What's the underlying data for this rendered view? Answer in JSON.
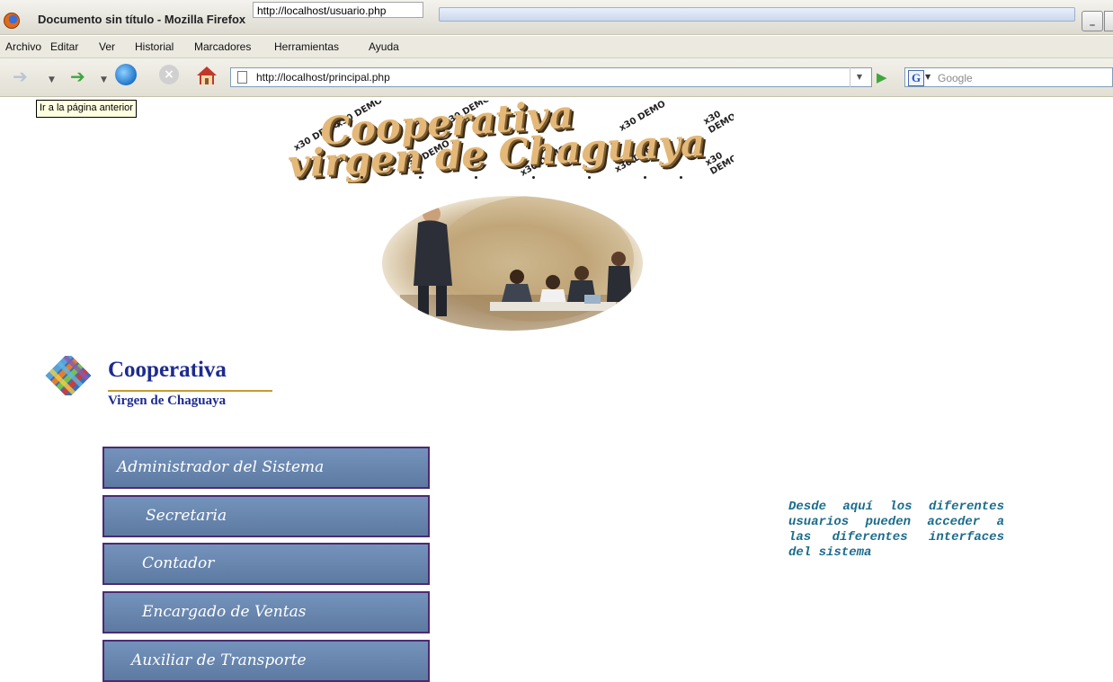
{
  "browser": {
    "window_title": "Documento sin título - Mozilla Firefox",
    "status_tooltip": "http://localhost/usuario.php",
    "minimize_glyph": "_",
    "menu": [
      "Archivo",
      "Editar",
      "Ver",
      "Historial",
      "Marcadores",
      "Herramientas",
      "Ayuda"
    ],
    "url": "http://localhost/principal.php",
    "search_placeholder": "Google",
    "search_engine_letter": "G",
    "back_tooltip": "Ir a la página anterior"
  },
  "page": {
    "banner": {
      "line1": "Cooperativa",
      "line2": "virgen de Chaguaya",
      "stamp_text": "x30 DEMO"
    },
    "logo": {
      "title": "Cooperativa",
      "subtitle": "Virgen de Chaguaya"
    },
    "roles": [
      "Administrador del Sistema",
      "Secretaria",
      "Contador",
      "Encargado de Ventas",
      "Auxiliar de Transporte"
    ],
    "info_text": "Desde aquí los diferentes usuarios pueden acceder a las diferentes interfaces del sistema"
  },
  "colors": {
    "button_fill": "#6a87ae",
    "button_border": "#4b2b72",
    "info_text": "#1b6c8c",
    "logo_text": "#1d2b8f"
  },
  "icons": [
    "firefox-logo-icon",
    "back-arrow-icon",
    "forward-arrow-icon",
    "reload-icon",
    "stop-icon",
    "home-icon",
    "page-icon",
    "go-icon",
    "google-search-icon"
  ]
}
